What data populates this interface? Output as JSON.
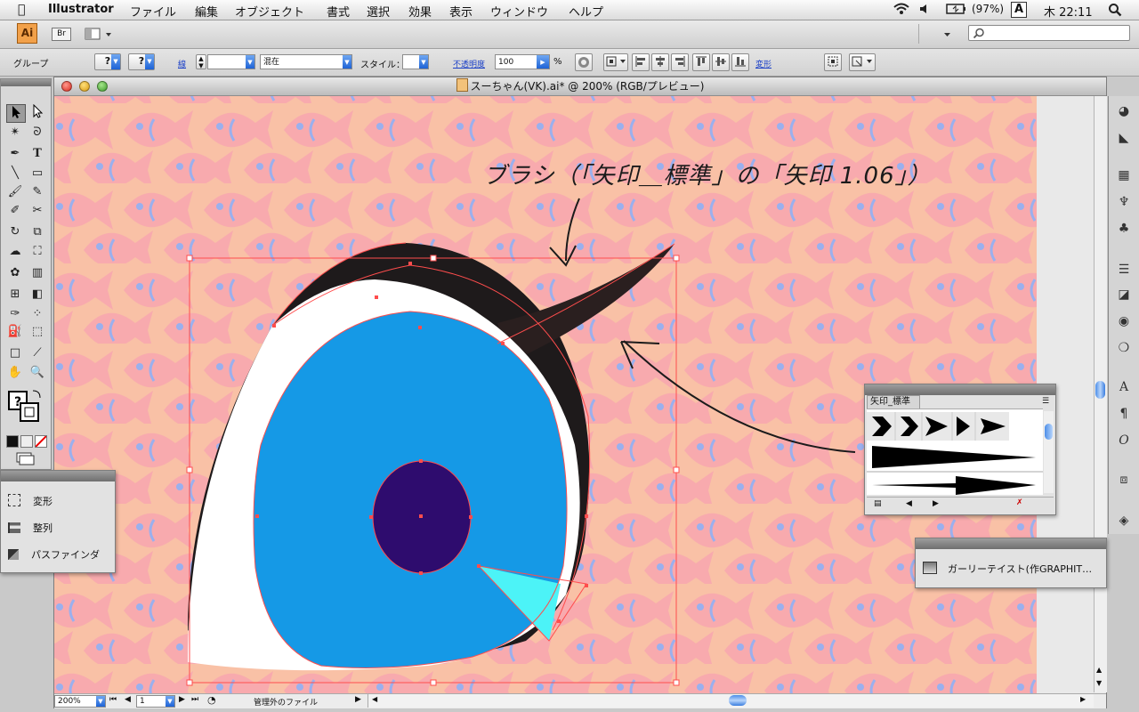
{
  "menubar": {
    "app_name": "Illustrator",
    "menus": [
      "ファイル",
      "編集",
      "オブジェクト",
      "書式",
      "選択",
      "効果",
      "表示",
      "ウィンドウ",
      "ヘルプ"
    ],
    "battery": "(97%)",
    "input_method": "A",
    "clock": "木 22:11"
  },
  "appbar": {
    "ai_badge": "Ai",
    "br_badge": "Br"
  },
  "control_bar": {
    "selection_label": "グループ",
    "stroke_label": "線",
    "brush_value": "混在",
    "style_label": "スタイル：",
    "opacity_label": "不透明度",
    "opacity_value": "100",
    "percent": "%",
    "transform_link": "変形"
  },
  "document": {
    "title": "スーちゃん(VK).ai* @ 200% (RGB/プレビュー)",
    "annotation": "ブラシ（「矢印＿標準」の「矢印 1.06」）",
    "zoom": "200%",
    "page": "1",
    "status_text": "管理外のファイル"
  },
  "brush_panel": {
    "tab_label": "矢印_標準"
  },
  "transform_panel": {
    "items": [
      "変形",
      "整列",
      "パスファインダ"
    ]
  },
  "graphic_style_panel": {
    "item": "ガーリーテイスト(作GRAPHIT…"
  },
  "colors": {
    "pattern_bg": "#f9c1a6",
    "fish": "#f8aaae",
    "iris": "#1599e6",
    "pupil": "#2e0c6e",
    "highlight": "#4cf3f7",
    "lash": "#1e1a1b",
    "selection": "#ff4d4d"
  }
}
